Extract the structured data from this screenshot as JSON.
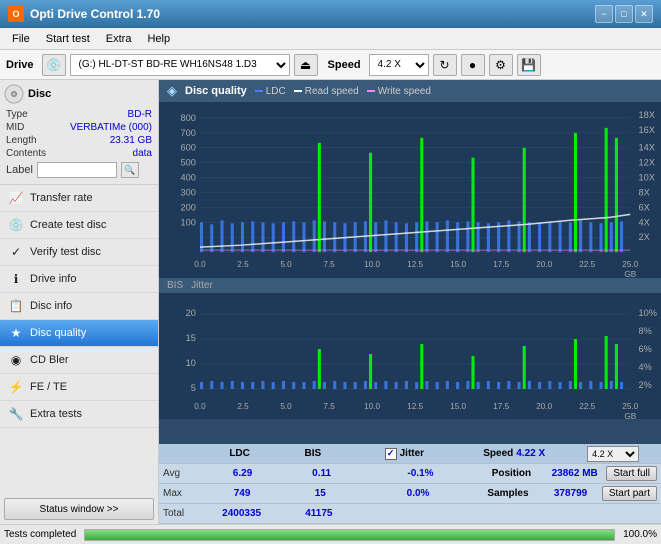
{
  "titleBar": {
    "title": "Opti Drive Control 1.70",
    "minimizeLabel": "−",
    "maximizeLabel": "□",
    "closeLabel": "✕"
  },
  "menuBar": {
    "items": [
      "File",
      "Start test",
      "Extra",
      "Help"
    ]
  },
  "toolbar": {
    "driveLabel": "Drive",
    "driveValue": "(G:)  HL-DT-ST BD-RE  WH16NS48 1.D3",
    "speedLabel": "Speed",
    "speedValue": "4.2 X"
  },
  "discInfo": {
    "type": "BD-R",
    "mid": "VERBATIMe (000)",
    "length": "23.31 GB",
    "contents": "data",
    "labelPlaceholder": ""
  },
  "navItems": [
    {
      "id": "transfer-rate",
      "label": "Transfer rate",
      "icon": "📈"
    },
    {
      "id": "create-test-disc",
      "label": "Create test disc",
      "icon": "💿"
    },
    {
      "id": "verify-test-disc",
      "label": "Verify test disc",
      "icon": "✓"
    },
    {
      "id": "drive-info",
      "label": "Drive info",
      "icon": "ℹ"
    },
    {
      "id": "disc-info",
      "label": "Disc info",
      "icon": "📋"
    },
    {
      "id": "disc-quality",
      "label": "Disc quality",
      "icon": "★",
      "active": true
    },
    {
      "id": "cd-bler",
      "label": "CD Bler",
      "icon": "◉"
    },
    {
      "id": "fe-te",
      "label": "FE / TE",
      "icon": "⚡"
    },
    {
      "id": "extra-tests",
      "label": "Extra tests",
      "icon": "🔧"
    }
  ],
  "statusWindow": {
    "label": "Status window >>"
  },
  "chartHeader": {
    "title": "Disc quality",
    "legends": [
      {
        "label": "LDC",
        "color": "#4080ff"
      },
      {
        "label": "Read speed",
        "color": "#ffffff"
      },
      {
        "label": "Write speed",
        "color": "#ff80ff"
      }
    ]
  },
  "chart1": {
    "yAxisLeft": [
      "800",
      "700",
      "600",
      "500",
      "400",
      "300",
      "200",
      "100"
    ],
    "yAxisRight": [
      "18X",
      "16X",
      "14X",
      "12X",
      "10X",
      "8X",
      "6X",
      "4X",
      "2X"
    ],
    "xAxisLabels": [
      "0.0",
      "2.5",
      "5.0",
      "7.5",
      "10.0",
      "12.5",
      "15.0",
      "17.5",
      "20.0",
      "22.5",
      "25.0"
    ]
  },
  "chart2": {
    "title": "BIS",
    "legend2": "Jitter",
    "yAxisLeft": [
      "20",
      "15",
      "10",
      "5"
    ],
    "yAxisRight": [
      "10%",
      "8%",
      "6%",
      "4%",
      "2%"
    ],
    "xAxisLabels": [
      "0.0",
      "2.5",
      "5.0",
      "7.5",
      "10.0",
      "12.5",
      "15.0",
      "17.5",
      "20.0",
      "22.5",
      "25.0"
    ]
  },
  "statsTable": {
    "headers": [
      "LDC",
      "BIS",
      "",
      "Jitter",
      "Speed",
      ""
    ],
    "rows": [
      {
        "label": "Avg",
        "ldc": "6.29",
        "bis": "0.11",
        "jitter": "-0.1%",
        "speedLabel": "Position",
        "speedValue": "23862 MB"
      },
      {
        "label": "Max",
        "ldc": "749",
        "bis": "15",
        "jitter": "0.0%",
        "speedLabel": "Samples",
        "speedValue": "378799"
      },
      {
        "label": "Total",
        "ldc": "2400335",
        "bis": "41175",
        "jitter": "",
        "speedLabel": "",
        "speedValue": ""
      }
    ],
    "jitterCheckbox": "✓",
    "speedDisplay": "4.22 X",
    "speedSelect": "4.2 X",
    "startFullBtn": "Start full",
    "startPartBtn": "Start part"
  },
  "statusBar": {
    "text": "Tests completed",
    "progress": 100,
    "progressText": "100.0%"
  }
}
